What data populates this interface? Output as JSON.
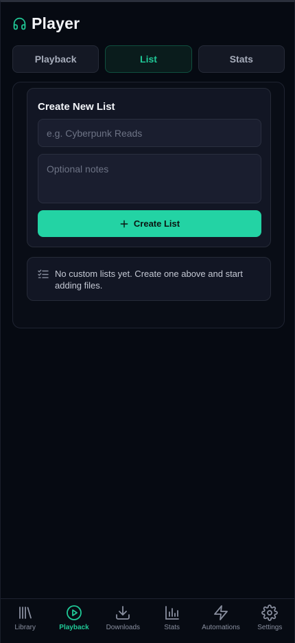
{
  "header": {
    "title": "Player",
    "icon": "headphones-icon",
    "accent": "#20c997"
  },
  "tabs": [
    {
      "label": "Playback",
      "active": false
    },
    {
      "label": "List",
      "active": true
    },
    {
      "label": "Stats",
      "active": false
    }
  ],
  "create_list": {
    "title": "Create New List",
    "name_placeholder": "e.g. Cyberpunk Reads",
    "name_value": "",
    "notes_placeholder": "Optional notes",
    "notes_value": "",
    "button_label": "Create List",
    "button_icon": "plus-icon",
    "button_color": "#23d3a4"
  },
  "empty_state": {
    "icon": "checklist-icon",
    "text": "No custom lists yet. Create one above and start adding files."
  },
  "bottom_nav": [
    {
      "label": "Library",
      "icon": "library-icon",
      "active": false
    },
    {
      "label": "Playback",
      "icon": "play-circle-icon",
      "active": true
    },
    {
      "label": "Downloads",
      "icon": "download-icon",
      "active": false
    },
    {
      "label": "Stats",
      "icon": "bar-chart-icon",
      "active": false
    },
    {
      "label": "Automations",
      "icon": "lightning-icon",
      "active": false
    },
    {
      "label": "Settings",
      "icon": "gear-icon",
      "active": false
    }
  ]
}
